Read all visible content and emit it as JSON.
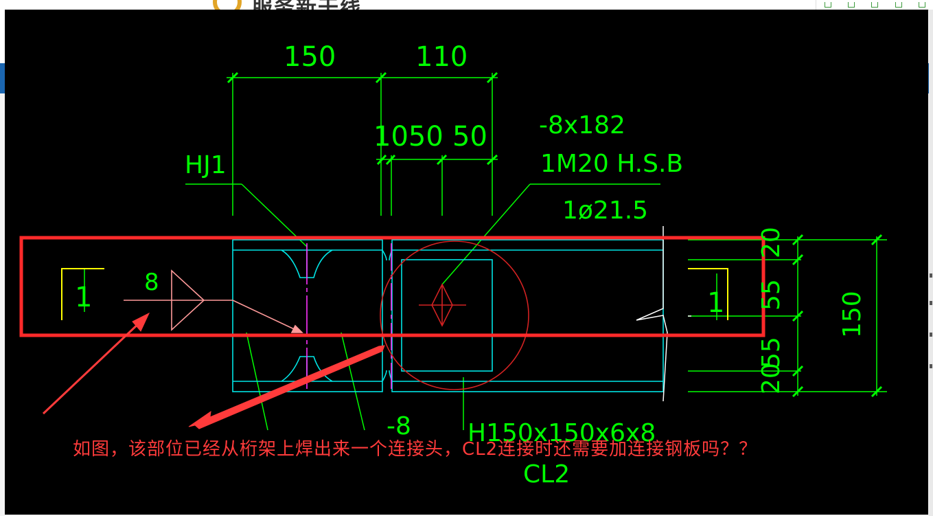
{
  "site": {
    "logo_text": "服务新干线"
  },
  "drawing": {
    "dim_top_left": "150",
    "dim_top_right": "110",
    "dim_mid_left": "1050",
    "dim_mid_right": "50",
    "plate_label": "-8x182",
    "bolt_label": "1M20 H.S.B",
    "hole_label": "1ø21.5",
    "truss_label": "HJ1",
    "weld_size": "8",
    "section_mark_left": "1",
    "section_mark_right": "1",
    "bottom_plate_label": "-8",
    "beam_section": "H150x150x6x8",
    "beam_name": "CL2",
    "dim_right_20_top": "20",
    "dim_right_55_top": "55",
    "dim_right_55_bottom": "55",
    "dim_right_20_bottom": "20",
    "dim_right_total": "150"
  },
  "annotation": {
    "note": "如图，该部位已经从桁架上焊出来一个连接头，CL2连接时还需要加连接钢板吗？？",
    "highlight_color": "#ff2a2a"
  }
}
